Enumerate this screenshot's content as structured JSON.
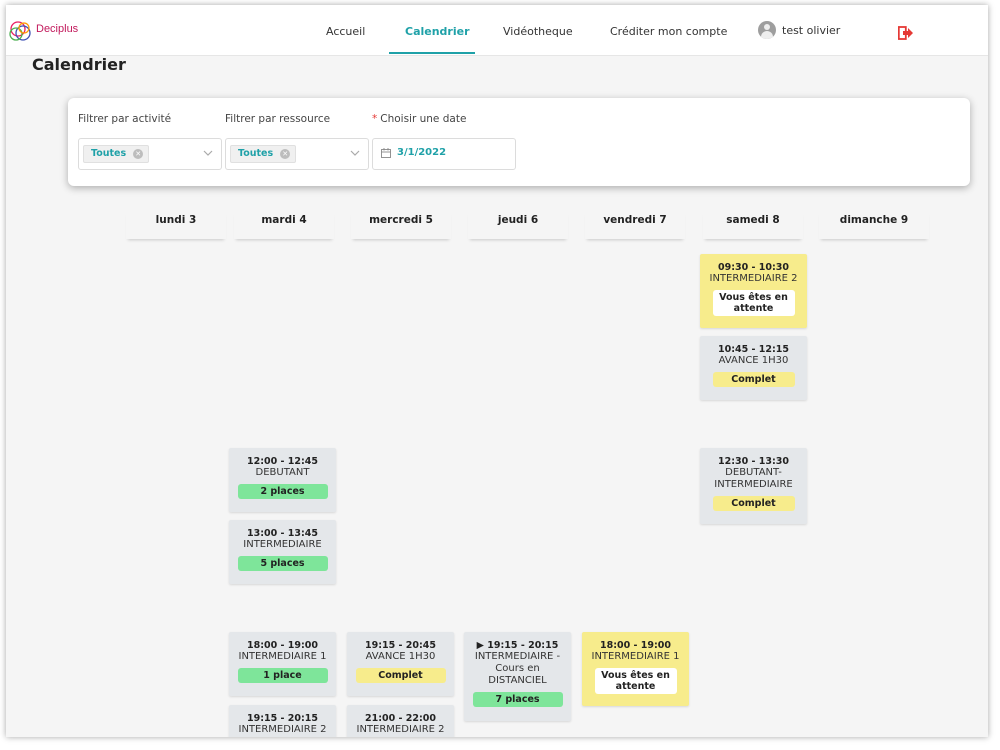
{
  "header": {
    "logo_text": "Deciplus",
    "nav": [
      {
        "label": "Accueil"
      },
      {
        "label": "Calendrier"
      },
      {
        "label": "Vidéotheque"
      },
      {
        "label": "Créditer mon compte"
      }
    ],
    "user_name": "test olivier"
  },
  "page": {
    "title": "Calendrier"
  },
  "filters": {
    "activity_label": "Filtrer par activité",
    "activity_value": "Toutes",
    "resource_label": "Filtrer par ressource",
    "resource_value": "Toutes",
    "date_required_mark": "*",
    "date_label": "Choisir une date",
    "date_value": "3/1/2022"
  },
  "days": [
    "lundi 3",
    "mardi 4",
    "mercredi 5",
    "jeudi 6",
    "vendredi 7",
    "samedi 8",
    "dimanche 9"
  ],
  "colors": {
    "accent": "#1fa1a8",
    "available": "#7ee59a",
    "full": "#f7ec8c",
    "card": "#e4e7ea",
    "logout": "#e53935"
  },
  "events": {
    "sat_1": {
      "time": "09:30 - 10:30",
      "name": "INTERMEDIAIRE 2",
      "status": "Vous êtes en attente"
    },
    "sat_2": {
      "time": "10:45 - 12:15",
      "name": "AVANCE 1H30",
      "status": "Complet"
    },
    "sat_3": {
      "time": "12:30 - 13:30",
      "name": "DEBUTANT-INTERMEDIAIRE",
      "status": "Complet"
    },
    "tue_1": {
      "time": "12:00 - 12:45",
      "name": "DEBUTANT",
      "status": "2 places"
    },
    "tue_2": {
      "time": "13:00 - 13:45",
      "name": "INTERMEDIAIRE",
      "status": "5 places"
    },
    "tue_3": {
      "time": "18:00 - 19:00",
      "name": "INTERMEDIAIRE 1",
      "status": "1 place"
    },
    "tue_4": {
      "time": "19:15 - 20:15",
      "name": "INTERMEDIAIRE 2"
    },
    "wed_1": {
      "time": "19:15 - 20:45",
      "name": "AVANCE 1H30",
      "status": "Complet"
    },
    "wed_2": {
      "time": "21:00 - 22:00",
      "name": "INTERMEDIAIRE 2"
    },
    "thu_1": {
      "time": "19:15 - 20:15",
      "name": "INTERMEDIAIRE - Cours en DISTANCIEL",
      "status": "7 places"
    },
    "fri_1": {
      "time": "18:00 - 19:00",
      "name": "INTERMEDIAIRE 1",
      "status": "Vous êtes en attente"
    }
  }
}
